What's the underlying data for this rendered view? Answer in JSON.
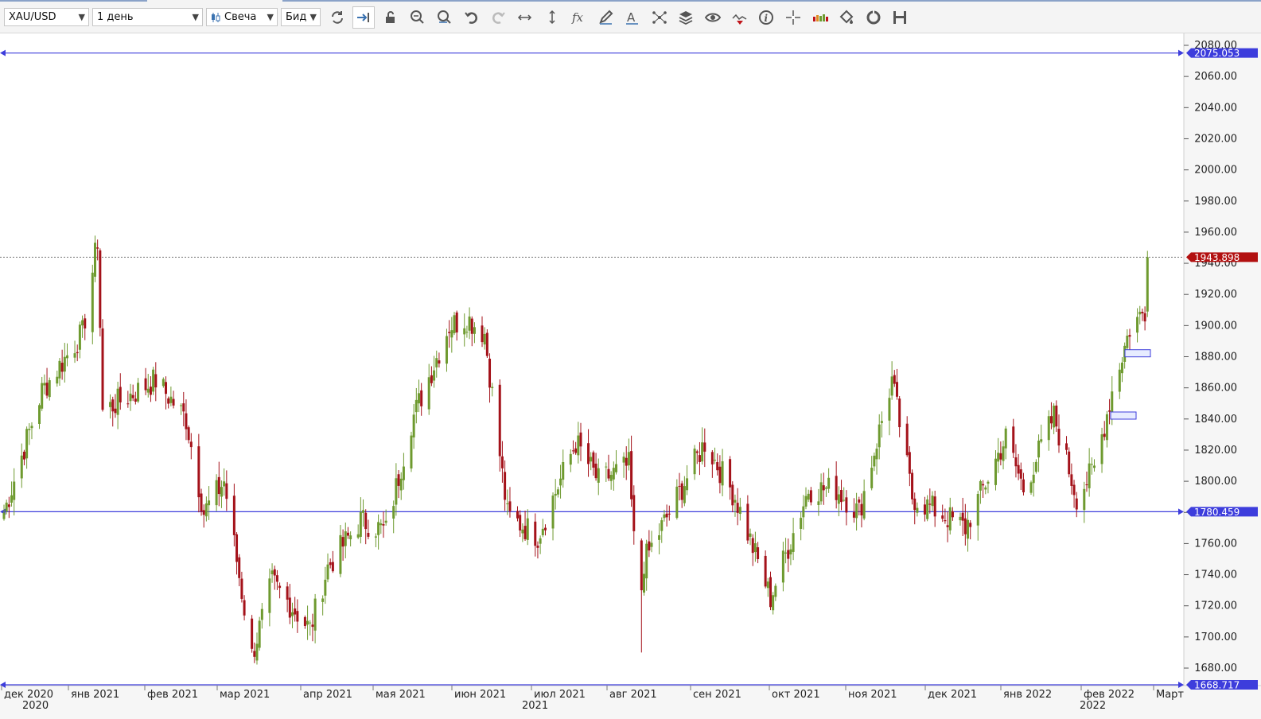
{
  "toolbar": {
    "symbol": "XAU/USD",
    "timeframe": "1 день",
    "chart_type": "Свеча",
    "price_type": "Бид",
    "icons": [
      "refresh-icon",
      "auto-scroll-icon",
      "lock-icon",
      "zoom-in-icon",
      "zoom-out-icon",
      "undo-icon",
      "redo-icon",
      "horizontal-scale-icon",
      "vertical-scale-icon",
      "formula-icon",
      "pencil-icon",
      "text-tool-icon",
      "network-icon",
      "layers-icon",
      "eye-icon",
      "signal-icon",
      "info-icon",
      "crosshair-icon",
      "volume-icon",
      "paint-bucket-icon",
      "cycle-icon",
      "save-icon"
    ]
  },
  "chart": {
    "y_ticks": [
      "2080.00",
      "2060.00",
      "2040.00",
      "2020.00",
      "2000.00",
      "1980.00",
      "1960.00",
      "1940.00",
      "1920.00",
      "1900.00",
      "1880.00",
      "1860.00",
      "1840.00",
      "1820.00",
      "1800.00",
      "1780.00",
      "1760.00",
      "1740.00",
      "1720.00",
      "1700.00",
      "1680.00"
    ],
    "x_months": [
      "дек 2020",
      "янв 2021",
      "фев 2021",
      "мар 2021",
      "апр 2021",
      "мая 2021",
      "июн 2021",
      "июл 2021",
      "авг 2021",
      "сен 2021",
      "окт 2021",
      "ноя 2021",
      "дек 2021",
      "янв 2022",
      "фев 2022",
      "Март"
    ],
    "x_years": [
      "2020",
      "2021",
      "2022"
    ],
    "lines": {
      "top": "2075.053",
      "mid": "1780.459",
      "bottom": "1668.717"
    },
    "current_price": "1943.898",
    "colors": {
      "up": "#6e9a2f",
      "down": "#a4121a",
      "line": "#3d3ddc",
      "current": "#b21010"
    }
  },
  "chart_data": {
    "type": "candlestick",
    "ylim": [
      1668,
      2083
    ],
    "x_start": "2020-11-30",
    "x_end": "2022-03-01",
    "price_lines": [
      2075.053,
      1780.459,
      1668.717
    ],
    "current_price": 1943.898,
    "series": [
      {
        "points": [
          [
            "2020-11-30",
            1780
          ],
          [
            "2020-12-15",
            1858
          ],
          [
            "2020-12-31",
            1895
          ],
          [
            "2021-01-06",
            1955
          ],
          [
            "2021-01-08",
            1845
          ],
          [
            "2021-01-29",
            1865
          ],
          [
            "2021-02-10",
            1840
          ],
          [
            "2021-02-17",
            1780
          ],
          [
            "2021-02-25",
            1800
          ],
          [
            "2021-03-08",
            1688
          ],
          [
            "2021-03-16",
            1735
          ],
          [
            "2021-03-31",
            1705
          ],
          [
            "2021-04-07",
            1745
          ],
          [
            "2021-04-20",
            1775
          ],
          [
            "2021-04-30",
            1768
          ],
          [
            "2021-05-10",
            1838
          ],
          [
            "2021-05-25",
            1900
          ],
          [
            "2021-06-01",
            1905
          ],
          [
            "2021-06-08",
            1895
          ],
          [
            "2021-06-17",
            1778
          ],
          [
            "2021-06-29",
            1765
          ],
          [
            "2021-07-14",
            1825
          ],
          [
            "2021-07-23",
            1800
          ],
          [
            "2021-08-04",
            1810
          ],
          [
            "2021-08-06",
            1762
          ],
          [
            "2021-08-09",
            1745
          ],
          [
            "2021-08-20",
            1780
          ],
          [
            "2021-09-03",
            1825
          ],
          [
            "2021-09-15",
            1790
          ],
          [
            "2021-09-29",
            1725
          ],
          [
            "2021-10-14",
            1795
          ],
          [
            "2021-10-25",
            1795
          ],
          [
            "2021-11-03",
            1780
          ],
          [
            "2021-11-16",
            1865
          ],
          [
            "2021-11-24",
            1790
          ],
          [
            "2021-12-15",
            1770
          ],
          [
            "2021-12-31",
            1828
          ],
          [
            "2022-01-07",
            1795
          ],
          [
            "2022-01-19",
            1842
          ],
          [
            "2022-01-28",
            1790
          ],
          [
            "2022-02-04",
            1808
          ],
          [
            "2022-02-11",
            1858
          ],
          [
            "2022-02-18",
            1898
          ],
          [
            "2022-02-24",
            1910
          ]
        ]
      }
    ]
  }
}
